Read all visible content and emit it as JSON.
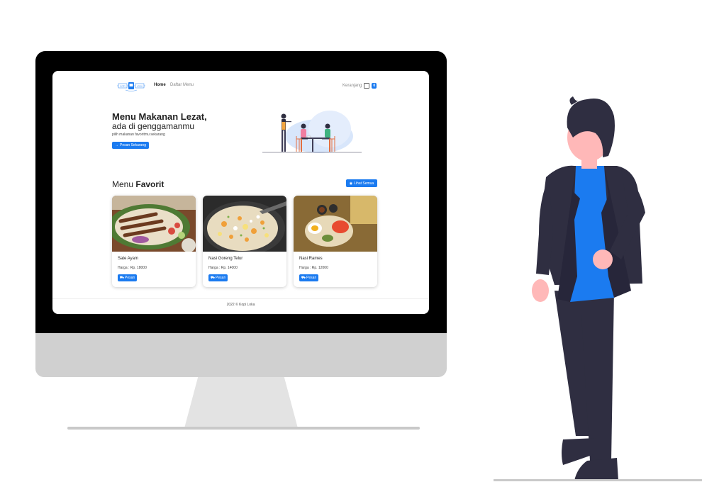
{
  "nav": {
    "logo_left": "KOPI",
    "logo_right": "LOKA",
    "home_label": "Home",
    "menu_label": "Daftar Menu",
    "cart_label": "Keranjang",
    "cart_count": "0"
  },
  "hero": {
    "title": "Menu Makanan Lezat,",
    "subtitle": "ada di genggamanmu",
    "description": "pilih makanan favoritmu sekarang",
    "cta_label": "Pesan Sekarang",
    "cta_icon": "arrow-right-icon"
  },
  "favorites": {
    "title_light": "Menu",
    "title_bold": "Favorit",
    "see_all_label": "Lihat Semua",
    "see_all_icon": "eye-icon",
    "items": [
      {
        "name": "Sate Ayam",
        "price": "Harga : Rp. 18000",
        "button": "Pesan"
      },
      {
        "name": "Nasi Goreng Telur",
        "price": "Harga : Rp. 14000",
        "button": "Pesan"
      },
      {
        "name": "Nasi Rames",
        "price": "Harga : Rp. 12000",
        "button": "Pesan"
      }
    ]
  },
  "footer": {
    "text": "2022 © Kopi Loka"
  },
  "colors": {
    "primary": "#1b7bf0",
    "bezel": "#000000",
    "chin": "#d0d0d0",
    "person_dark": "#2f2e41",
    "person_shirt": "#1b7bf0"
  }
}
